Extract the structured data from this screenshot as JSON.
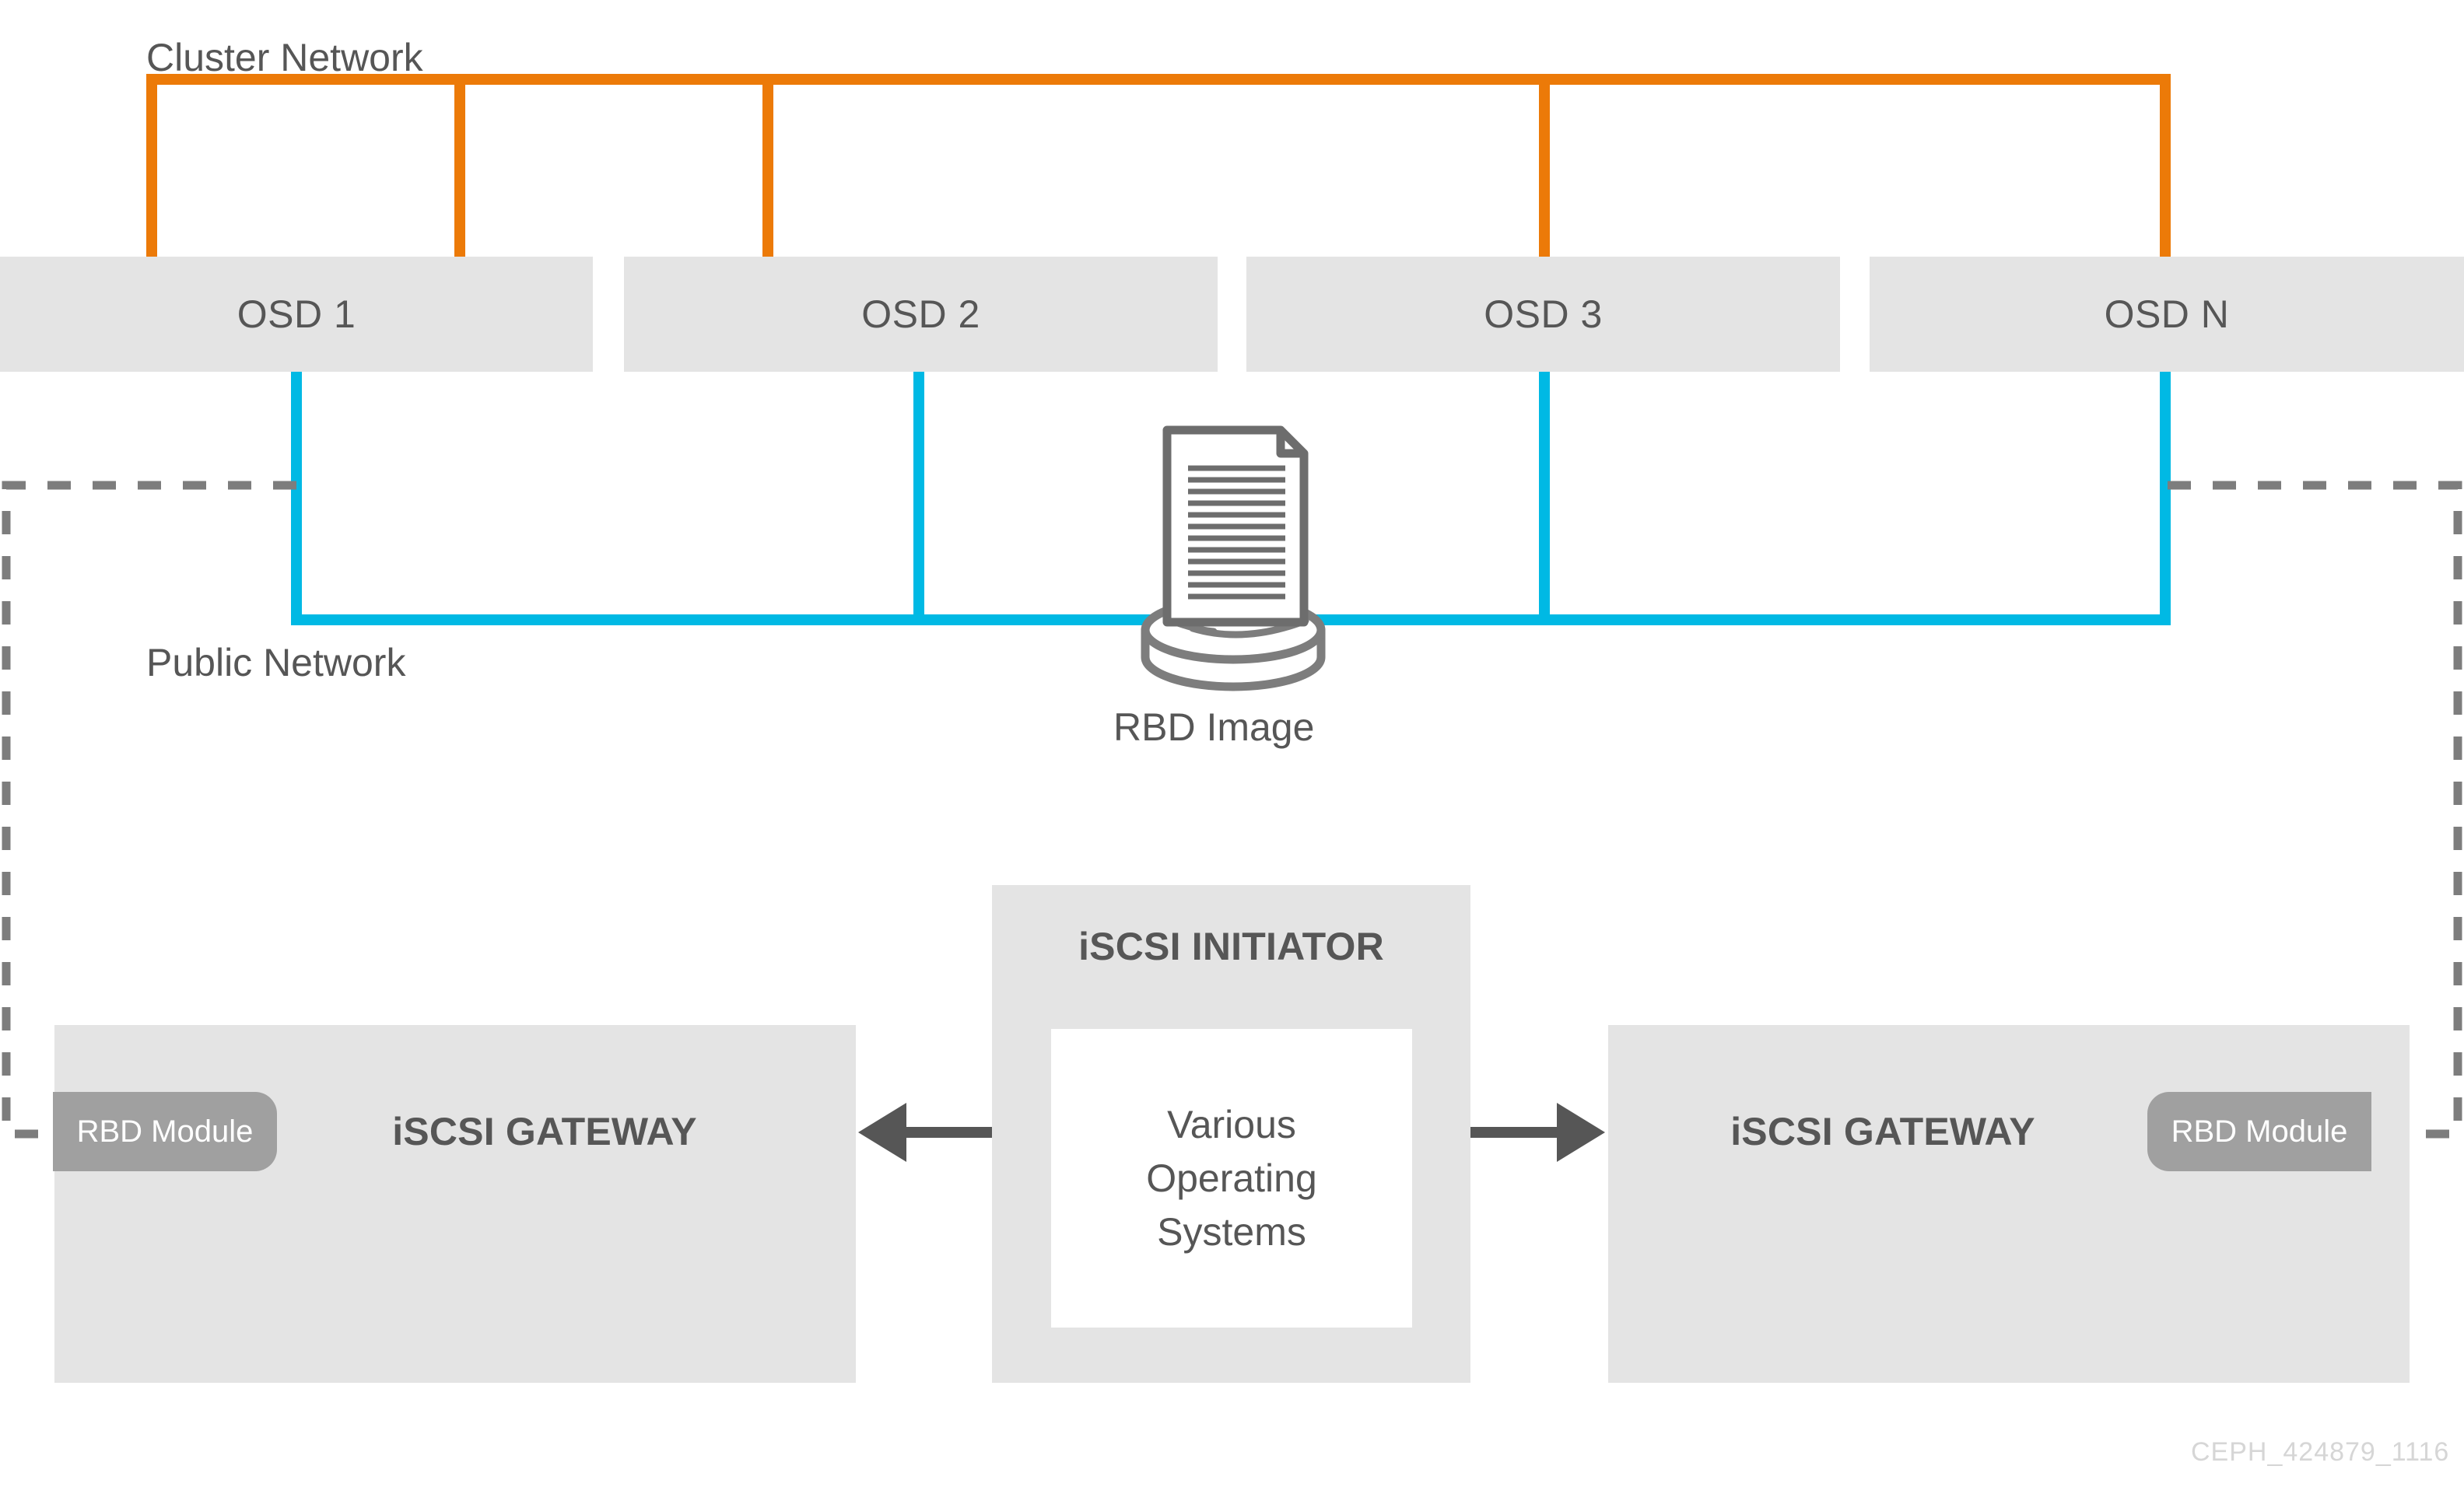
{
  "diagram": {
    "title_watermark": "CEPH_424879_1116",
    "networks": {
      "cluster": {
        "label": "Cluster Network",
        "color": "#ec7a08"
      },
      "public": {
        "label": "Public Network",
        "color": "#00b9e4"
      }
    },
    "osd_nodes": [
      {
        "label": "OSD 1"
      },
      {
        "label": "OSD 2"
      },
      {
        "label": "OSD 3"
      },
      {
        "label": "OSD N"
      }
    ],
    "rbd_image": {
      "caption": "RBD Image",
      "icon": "document-on-cylinder-icon"
    },
    "initiator": {
      "title": "iSCSI INITIATOR",
      "inner_lines": [
        "Various",
        "Operating",
        "Systems"
      ]
    },
    "gateways": [
      {
        "title": "iSCSI GATEWAY",
        "module_label": "RBD Module",
        "side": "left"
      },
      {
        "title": "iSCSI GATEWAY",
        "module_label": "RBD Module",
        "side": "right"
      }
    ],
    "colors": {
      "box_fill": "#e4e4e4",
      "pill_fill": "#a0a0a0",
      "text": "#565656",
      "dashed_line": "#7d7d7d",
      "arrow": "#565656",
      "watermark": "#d6d6d6"
    }
  }
}
